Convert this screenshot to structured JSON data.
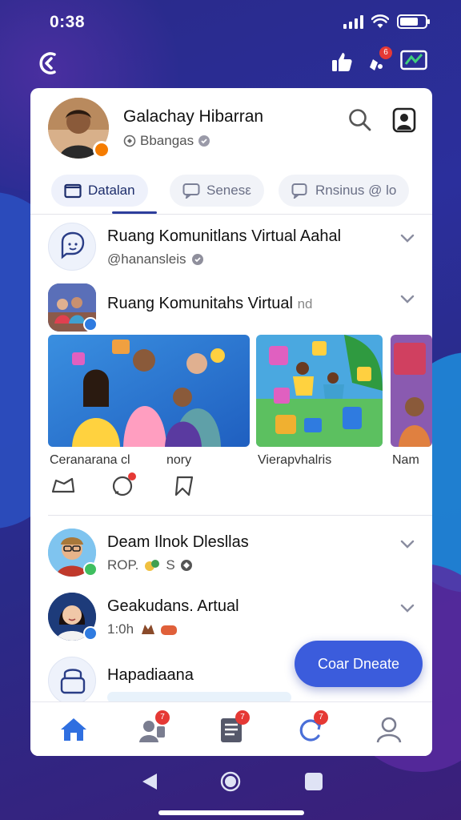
{
  "status": {
    "time": "0:38"
  },
  "topbar": {
    "notif_count": "6"
  },
  "profile": {
    "name": "Galachay Hibarran",
    "sub": "Bbangas"
  },
  "tabs": [
    {
      "label": "Datalan",
      "active": true
    },
    {
      "label": "Senesε",
      "active": false
    },
    {
      "label": "Rnsinus @ lo",
      "active": false
    }
  ],
  "rows": {
    "r1": {
      "title": "Ruang Komunitlans Virtual Aahal",
      "sub": "@hanansleis"
    },
    "r2": {
      "title": "Ruang Komunitahs Virtual",
      "suffix": "nd"
    },
    "r3": {
      "title": "Deam Ilnok Dlesllas",
      "sub": "ROP.",
      "sub2": "S"
    },
    "r4": {
      "title": "Geakudans. Artual",
      "sub": "1:0h"
    },
    "r5": {
      "title": "Hapadiaana"
    }
  },
  "captions": [
    "Ceranarana cl",
    "nory",
    "Vierapvhalris",
    "Nam"
  ],
  "fab": {
    "label": "Coar Dneate"
  },
  "bottomnav": {
    "items": [
      {
        "name": "home",
        "badge": ""
      },
      {
        "name": "friends",
        "badge": "7"
      },
      {
        "name": "news",
        "badge": "7"
      },
      {
        "name": "refresh",
        "badge": "7"
      },
      {
        "name": "profile",
        "badge": ""
      }
    ]
  },
  "colors": {
    "accent": "#3b5cdc",
    "tab_active": "#1d2d6b",
    "badge": "#e53935",
    "home_active": "#2f6fe0"
  }
}
